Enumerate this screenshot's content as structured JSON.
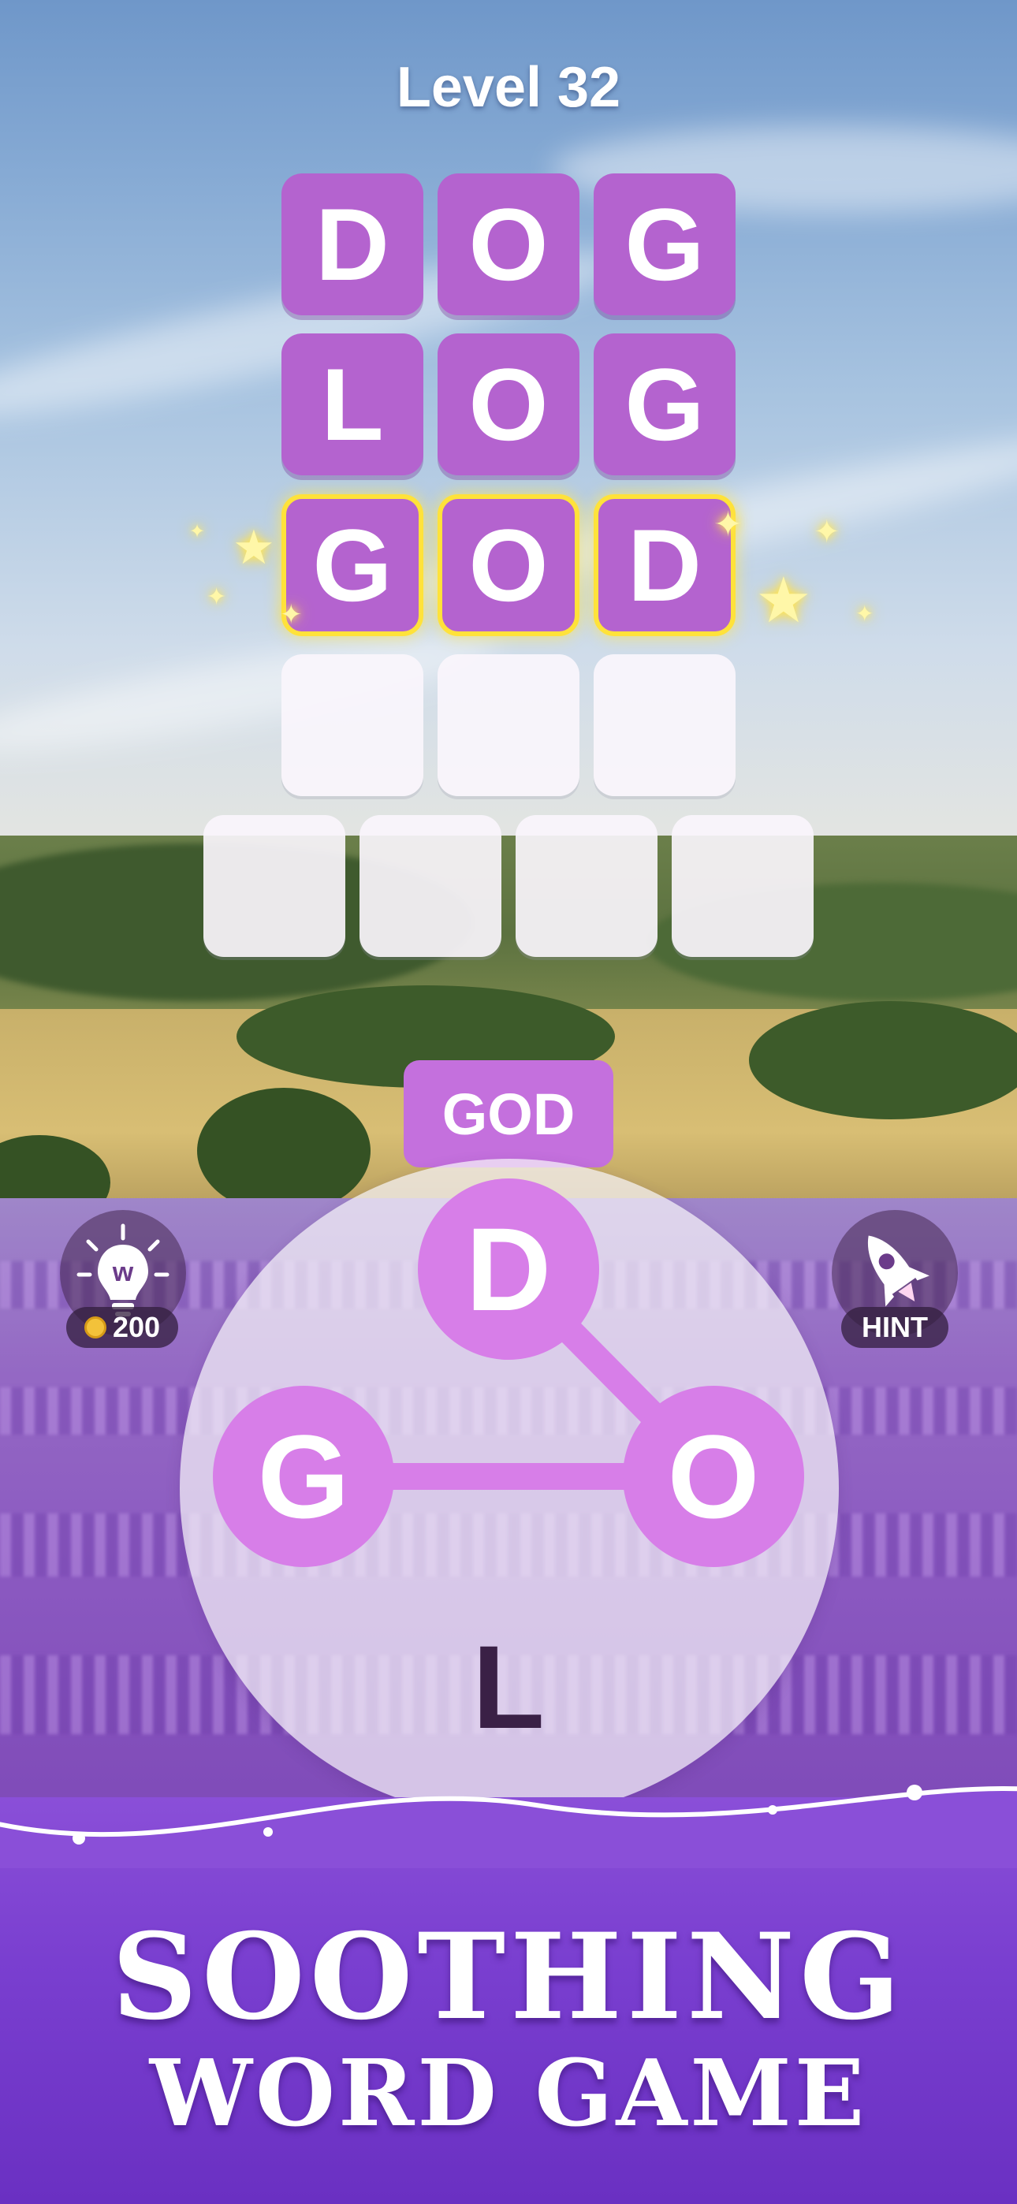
{
  "header": {
    "level_label": "Level 32"
  },
  "grid": {
    "rows": [
      {
        "letters": [
          "D",
          "O",
          "G"
        ],
        "state": "filled"
      },
      {
        "letters": [
          "L",
          "O",
          "G"
        ],
        "state": "filled"
      },
      {
        "letters": [
          "G",
          "O",
          "D"
        ],
        "state": "found"
      },
      {
        "letters": [
          "",
          "",
          ""
        ],
        "state": "empty"
      },
      {
        "letters": [
          "",
          "",
          "",
          ""
        ],
        "state": "empty"
      }
    ]
  },
  "current_word": "GOD",
  "wheel": {
    "letters": [
      {
        "char": "D",
        "selected": true
      },
      {
        "char": "O",
        "selected": true
      },
      {
        "char": "G",
        "selected": true
      },
      {
        "char": "L",
        "selected": false
      }
    ]
  },
  "buttons": {
    "bulb": {
      "icon": "lightbulb-icon",
      "cost": "200"
    },
    "rocket": {
      "icon": "rocket-icon",
      "label": "HINT"
    }
  },
  "banner": {
    "line1": "SOOTHING",
    "line2": "WORD GAME"
  },
  "colors": {
    "tile": "#b463cf",
    "highlight": "#ffe23a",
    "wheel_selected": "#d77ee8",
    "banner": "#7a3fd0"
  }
}
